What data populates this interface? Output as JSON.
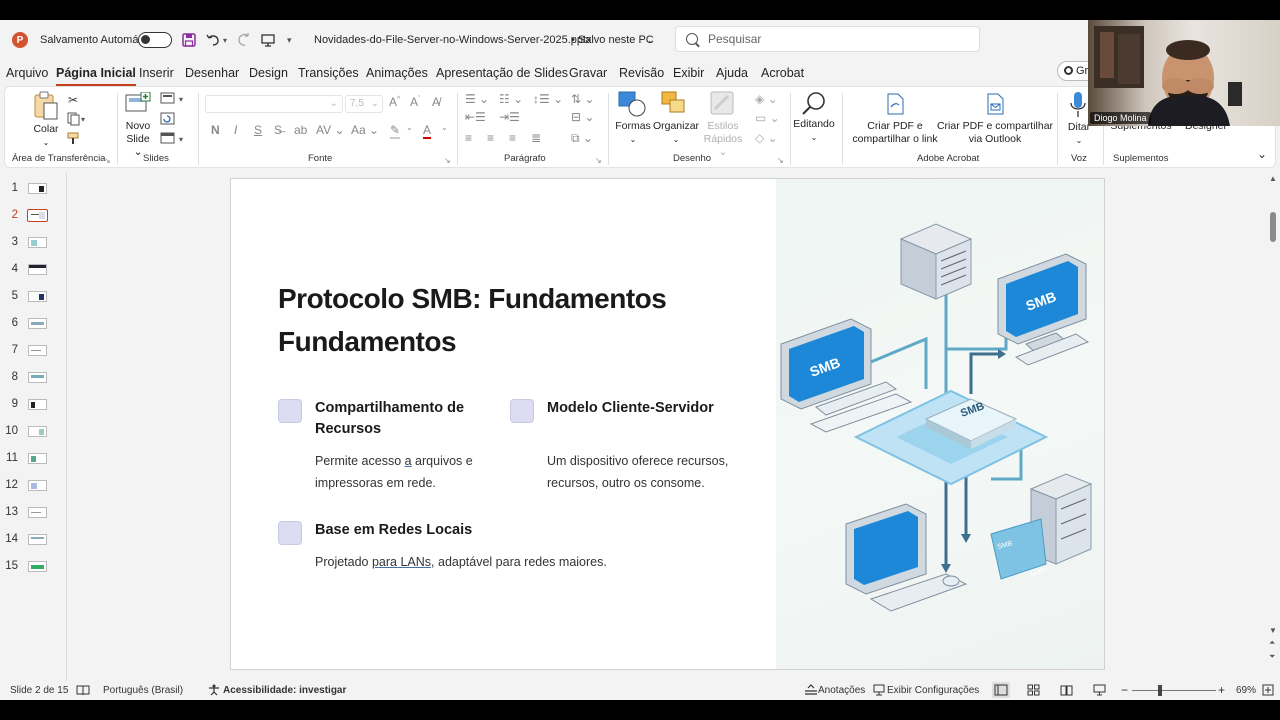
{
  "titlebar": {
    "autosave_label": "Salvamento Automático",
    "filename": "Novidades-do-File-Server-no-Windows-Server-2025.pptx",
    "save_status": "• Salvo neste PC",
    "search_placeholder": "Pesquisar"
  },
  "menu": [
    "Arquivo",
    "Página Inicial",
    "Inserir",
    "Desenhar",
    "Design",
    "Transições",
    "Animações",
    "Apresentação de Slides",
    "Gravar",
    "Revisão",
    "Exibir",
    "Ajuda",
    "Acrobat"
  ],
  "menu_active": "Página Inicial",
  "ribbon": {
    "colar": "Colar",
    "area_transferencia": "Área de Transferência",
    "novo_slide_1": "Novo",
    "novo_slide_2": "Slide",
    "slides": "Slides",
    "font_size": "7,5",
    "fonte": "Fonte",
    "paragrafo": "Parágrafo",
    "formas": "Formas",
    "organizar": "Organizar",
    "estilos_1": "Estilos",
    "estilos_2": "Rápidos",
    "desenho": "Desenho",
    "editando": "Editando",
    "criar_pdf_link_1": "Criar PDF e",
    "criar_pdf_link_2": "compartilhar o link",
    "criar_pdf_outlook_1": "Criar PDF e compartilhar",
    "criar_pdf_outlook_2": "via Outlook",
    "adobe_acrobat": "Adobe Acrobat",
    "ditar": "Ditar",
    "voz": "Voz",
    "suplementos": "Suplementos",
    "suplementos_group": "Suplementos",
    "designer": "Designer",
    "gravar_btn": "Gra"
  },
  "thumbnails": [
    "1",
    "2",
    "3",
    "4",
    "5",
    "6",
    "7",
    "8",
    "9",
    "10",
    "11",
    "12",
    "13",
    "14",
    "15"
  ],
  "selected_slide": "2",
  "slide": {
    "title_line1": "Protocolo SMB: Fundamentos",
    "title_line2": "Fundamentos",
    "f1_head_1": "Compartilhamento de",
    "f1_head_2": "Recursos",
    "f1_desc_a": "Permite acesso ",
    "f1_desc_b": "a",
    "f1_desc_c": " arquivos e",
    "f1_desc_2": "impressoras em rede.",
    "f2_head": "Modelo Cliente-Servidor",
    "f2_desc_1": "Um dispositivo oferece recursos,",
    "f2_desc_2": "recursos, outro os consome.",
    "f3_head": "Base em Redes Locais",
    "f3_desc_a": "Projetado ",
    "f3_desc_b": "para LANs",
    "f3_desc_c": ", adaptável para redes maiores.",
    "art_label_smb1": "SMB",
    "art_label_smb2": "SMB",
    "art_label_smb3": "SMB",
    "art_label_small": "SMB",
    "art_label_com": "Com"
  },
  "status": {
    "slide_count": "Slide 2 de 15",
    "language": "Português (Brasil)",
    "accessibility": "Acessibilidade: investigar",
    "notes": "Anotações",
    "display_settings": "Exibir Configurações",
    "zoom": "69%"
  },
  "webcam": {
    "name": "Diogo Molina"
  },
  "colors": {
    "accent": "#c43e1c",
    "ppt_brand": "#d35230",
    "smb_blue": "#1e88d8"
  }
}
